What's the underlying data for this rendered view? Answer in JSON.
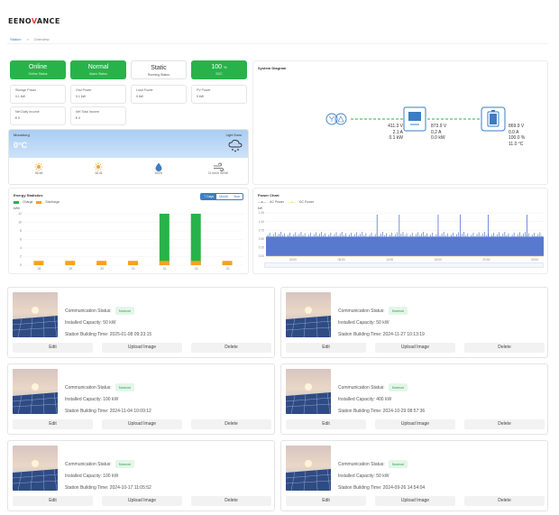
{
  "brand": {
    "logo_prefix": "EENO",
    "logo_accent": "V",
    "logo_suffix": "ANCE"
  },
  "breadcrumb": {
    "home": "Station",
    "separator": ">",
    "current": "Overview"
  },
  "status": [
    {
      "value": "Online",
      "label": "Online Status"
    },
    {
      "value": "Normal",
      "label": "Alarm Status"
    },
    {
      "value": "Static",
      "label": "Running Status"
    },
    {
      "value": "100",
      "unit": "%",
      "label": "SOC"
    }
  ],
  "metrics": [
    {
      "label": "Storage Power",
      "value": "0.1 kW"
    },
    {
      "label": "Grid Power",
      "value": "0.1 kW"
    },
    {
      "label": "Load Power",
      "value": "0 kW"
    },
    {
      "label": "PV Power",
      "value": "0 kW"
    },
    {
      "label": "Net Daily Income",
      "value": "€ 0"
    },
    {
      "label": "Net Total Income",
      "value": "€ 0"
    }
  ],
  "weather": {
    "location": "Moosburg",
    "temperature": "0°C",
    "condition": "Light Snow",
    "items": [
      {
        "icon": "sunrise-icon",
        "value": "06:46"
      },
      {
        "icon": "sunset-icon",
        "value": "16:41"
      },
      {
        "icon": "humidity-icon",
        "value": "100%"
      },
      {
        "icon": "wind-icon",
        "value": "11 km/h WSW"
      }
    ]
  },
  "system_diagram": {
    "title": "System Diagram",
    "meter": [
      "411.3 V",
      "2.1 A",
      "0.1 kW"
    ],
    "inverter": [
      "873.9 V",
      "0.2 A",
      "0.0 kW"
    ],
    "battery": [
      "869.9 V",
      "0.0 A",
      "100.0 %",
      "11.0 °C"
    ]
  },
  "energy": {
    "title": "Energy Statistics",
    "unit": "kWh",
    "tabs": [
      "7 Days",
      "Month",
      "Year"
    ],
    "active_tab": 0
  },
  "power": {
    "title": "Power Chart",
    "unit": "kW",
    "legend": [
      "AC Power",
      "DC Power"
    ],
    "x_ticks": [
      "02:00",
      "06:00",
      "12:00",
      "16:00",
      "20:00",
      "00:00"
    ]
  },
  "chart_data": [
    {
      "type": "bar",
      "title": "Energy Statistics",
      "ylabel": "kWh",
      "categories": [
        "28",
        "29",
        "30",
        "31",
        "01",
        "02",
        "03"
      ],
      "series": [
        {
          "name": "Charge",
          "color": "#27b34a",
          "values": [
            0,
            0,
            0,
            0,
            12,
            12,
            0
          ]
        },
        {
          "name": "Discharge",
          "color": "#f5a21b",
          "values": [
            1,
            1,
            1,
            1,
            1,
            1,
            1
          ]
        }
      ],
      "y_ticks": [
        "12",
        "10",
        "8",
        "6",
        "4",
        "2",
        "0"
      ],
      "ylim": [
        0,
        12
      ]
    },
    {
      "type": "area",
      "title": "Power Chart",
      "ylabel": "kW",
      "y_ticks": [
        "1.25",
        "1.00",
        "0.75",
        "0.50",
        "0.25",
        "0.00"
      ],
      "ylim": [
        0,
        1.25
      ],
      "series": [
        {
          "name": "AC Power",
          "color": "#3b62c4"
        },
        {
          "name": "DC Power",
          "color": "#f5c23b"
        }
      ]
    }
  ],
  "station_labels": {
    "comm": "Communication Status:",
    "capacity": "Installed Capacity:",
    "building": "Station Building Time:",
    "edit": "Edit",
    "upload": "Upload Image",
    "delete": "Delete"
  },
  "stations": [
    {
      "status": "Normal",
      "capacity": "50 kW",
      "time": "2025-01-08 09:33:15"
    },
    {
      "status": "Normal",
      "capacity": "50 kW",
      "time": "2024-11-27 10:13:19"
    },
    {
      "status": "Normal",
      "capacity": "100 kW",
      "time": "2024-11-04 10:09:12"
    },
    {
      "status": "Normal",
      "capacity": "400 kW",
      "time": "2024-10-29 08:57:36"
    },
    {
      "status": "Normal",
      "capacity": "100 kW",
      "time": "2024-10-17 11:05:52"
    },
    {
      "status": "Normal",
      "capacity": "50 kW",
      "time": "2024-09-26 14:54:04"
    }
  ]
}
